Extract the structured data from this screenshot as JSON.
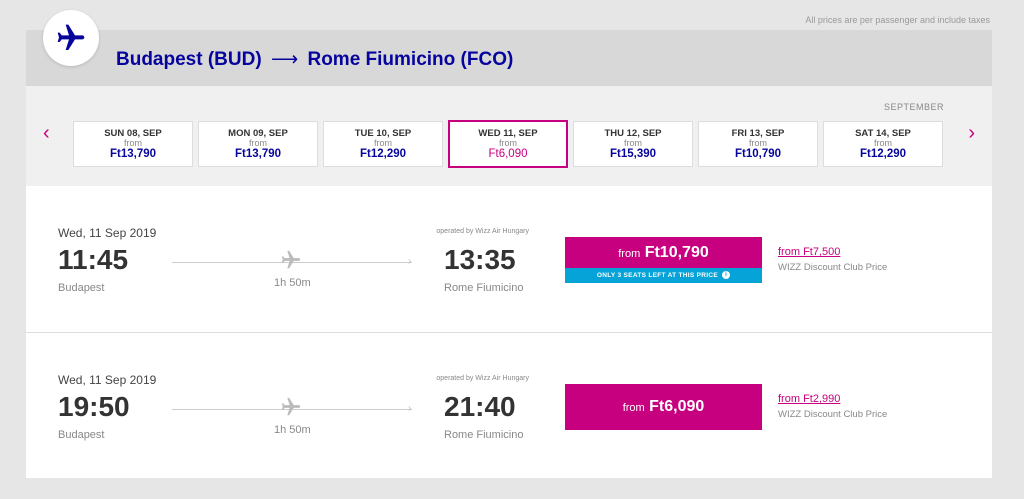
{
  "price_note": "All prices are per passenger and include taxes",
  "route": {
    "origin": "Budapest (BUD)",
    "arrow": "⟶",
    "destination": "Rome Fiumicino (FCO)"
  },
  "calendar": {
    "month": "SEPTEMBER",
    "prev_arrow": "‹",
    "next_arrow": "›",
    "days": [
      {
        "label": "SUN 08, SEP",
        "from": "from",
        "price": "Ft13,790"
      },
      {
        "label": "MON 09, SEP",
        "from": "from",
        "price": "Ft13,790"
      },
      {
        "label": "TUE 10, SEP",
        "from": "from",
        "price": "Ft12,290"
      },
      {
        "label": "WED 11, SEP",
        "from": "from",
        "price": "Ft6,090",
        "selected": true
      },
      {
        "label": "THU 12, SEP",
        "from": "from",
        "price": "Ft15,390"
      },
      {
        "label": "FRI 13, SEP",
        "from": "from",
        "price": "Ft10,790"
      },
      {
        "label": "SAT 14, SEP",
        "from": "from",
        "price": "Ft12,290"
      }
    ]
  },
  "flights": [
    {
      "date": "Wed, 11 Sep 2019",
      "dep_time": "11:45",
      "dep_city": "Budapest",
      "duration": "1h 50m",
      "operated_by": "operated by Wizz Air Hungary",
      "arr_time": "13:35",
      "arr_city": "Rome Fiumicino",
      "price_from": "from",
      "price": "Ft10,790",
      "seats_note": "ONLY 3 SEATS LEFT AT THIS PRICE",
      "club_from": "from",
      "club_price": "Ft7,500",
      "club_label": "WIZZ Discount Club Price"
    },
    {
      "date": "Wed, 11 Sep 2019",
      "dep_time": "19:50",
      "dep_city": "Budapest",
      "duration": "1h 50m",
      "operated_by": "operated by Wizz Air Hungary",
      "arr_time": "21:40",
      "arr_city": "Rome Fiumicino",
      "price_from": "from",
      "price": "Ft6,090",
      "club_from": "from",
      "club_price": "Ft2,990",
      "club_label": "WIZZ Discount Club Price"
    }
  ],
  "colors": {
    "brand_navy": "#06049d",
    "brand_magenta": "#c6007e",
    "alert_blue": "#06a3d9"
  }
}
